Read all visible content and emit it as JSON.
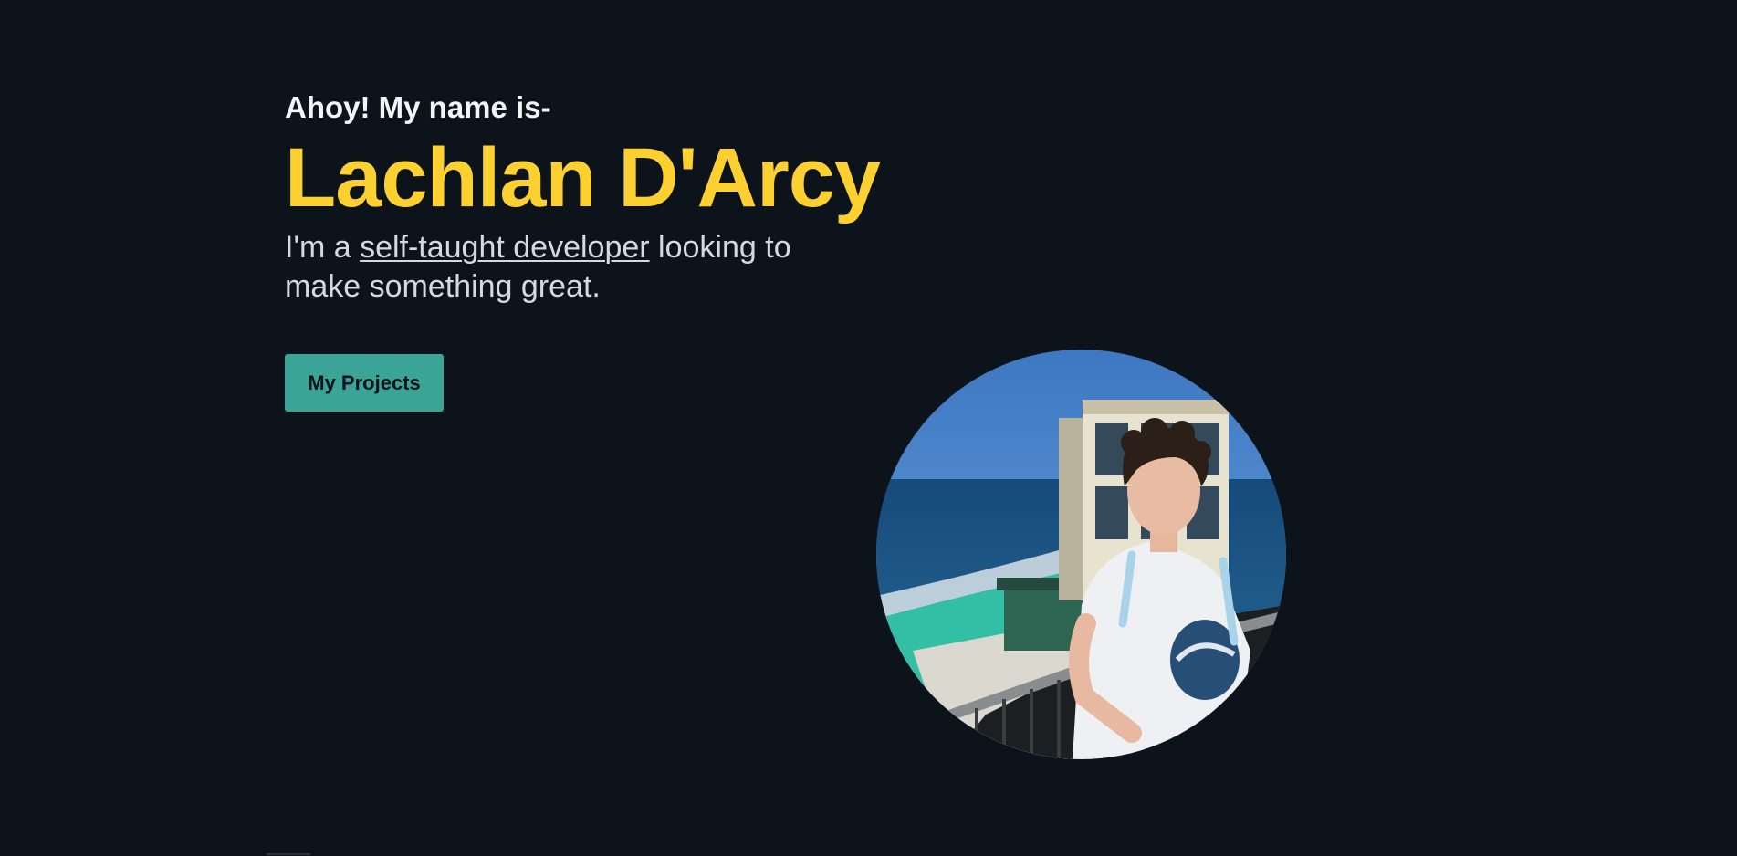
{
  "hero": {
    "greeting": "Ahoy! My name is-",
    "name": "Lachlan D'Arcy",
    "tagline_before": "I'm a ",
    "tagline_link": "self-taught developer",
    "tagline_after": " looking to make something great."
  },
  "cta": {
    "label": "My Projects"
  },
  "photo": {
    "alt": "Lachlan D'Arcy"
  },
  "colors": {
    "background": "#0d131b",
    "name": "#fcd031",
    "button": "#3aa597",
    "text": "#d6dae0"
  }
}
